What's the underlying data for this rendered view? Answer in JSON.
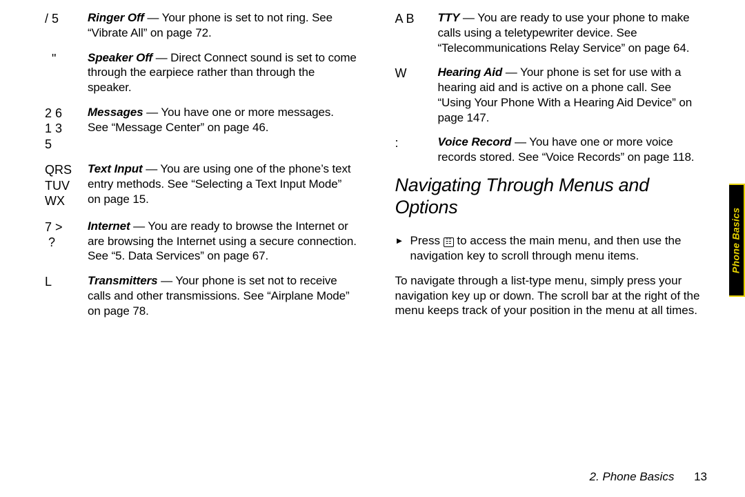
{
  "left": [
    {
      "sym": "/ 5",
      "term": "Ringer Off",
      "text": " — Your phone is set to not ring. See “Vibrate All” on page 72."
    },
    {
      "sym": "  \"",
      "term": "Speaker Off",
      "text": " — Direct Connect sound is set to come through the earpiece rather than through the speaker."
    },
    {
      "sym": "2 6\n1 3\n5",
      "term": "Messages",
      "text": " — You have one or more messages. See “Message Center” on page 46."
    },
    {
      "sym": "QRS\nTUV\nWX",
      "term": "Text Input",
      "text": " — You are using one of the phone’s text entry methods. See “Selecting a Text Input Mode” on page 15."
    },
    {
      "sym": "7 >\n ?",
      "term": "Internet",
      "text": " — You are ready to browse the Internet or are browsing the Internet using a secure connection. See “5. Data Services” on page 67."
    },
    {
      "sym": "L",
      "term": "Transmitters",
      "text": " — Your phone is set not to receive calls and other transmissions. See “Airplane Mode” on page 78."
    }
  ],
  "right": [
    {
      "sym": "A B",
      "term": "TTY",
      "text": " — You are ready to use your phone to make calls using a teletypewriter device. See “Telecommunications Relay Service” on page 64."
    },
    {
      "sym": "W",
      "term": "Hearing Aid",
      "text": " — Your phone is set for use with a hearing aid and is active on a phone call. See “Using Your Phone With a Hearing Aid Device” on page 147."
    },
    {
      "sym": ":",
      "term": "Voice Record",
      "text": " — You have one or more voice records stored. See “Voice Records” on page 118."
    }
  ],
  "section_heading": "Navigating Through Menus and Options",
  "bullet": {
    "pre": "Press ",
    "key": "☷",
    "post": " to access the main menu, and then use the navigation key to scroll through menu items."
  },
  "paragraph": "To navigate through a list-type menu, simply press your navigation key up or down. The scroll bar at the right of the menu keeps track of your position in the menu at all times.",
  "footer": {
    "chapter": "2. Phone Basics",
    "page": "13"
  },
  "side_tab": "Phone Basics"
}
